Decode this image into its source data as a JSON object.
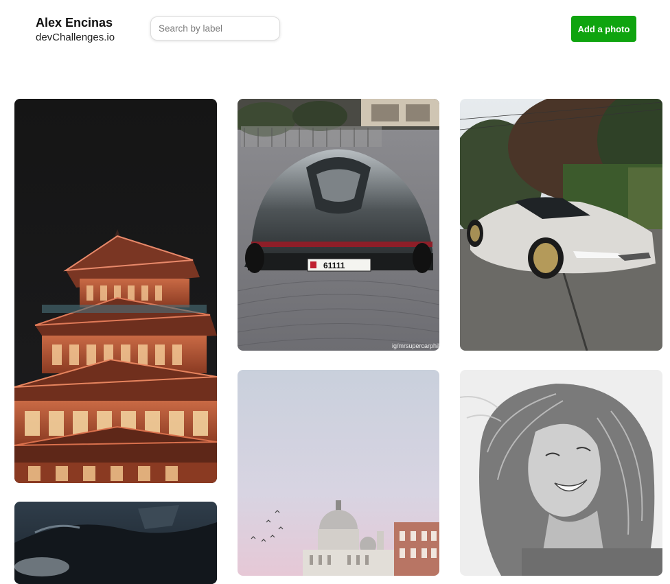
{
  "header": {
    "brand_name": "Alex Encinas",
    "brand_sub": "devChallenges.io",
    "search_placeholder": "Search by label",
    "search_value": "",
    "add_button_label": "Add a photo"
  },
  "colors": {
    "accent": "#0fa40f",
    "text": "#111111"
  },
  "photos": [
    {
      "subject": "pagoda temple at night",
      "watermark": ""
    },
    {
      "subject": "silver supercar rear view on cobblestones",
      "plate_text": "61111",
      "watermark": "ig/mrsupercarphile"
    },
    {
      "subject": "white supercar parked on street"
    },
    {
      "subject": "laughing woman with windswept hair, black and white"
    },
    {
      "subject": "domed cathedral under pastel sky"
    },
    {
      "subject": "car interior close-up"
    }
  ]
}
